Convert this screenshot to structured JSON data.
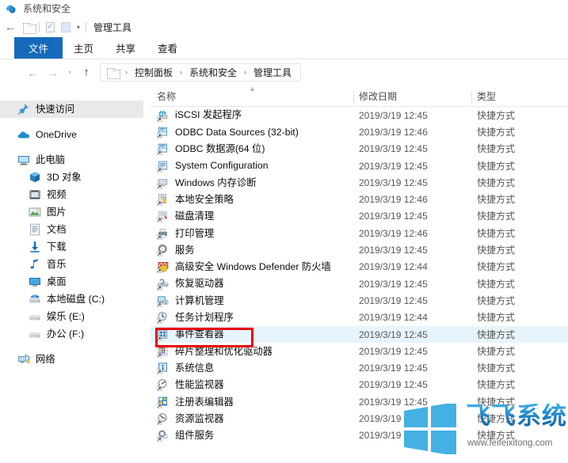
{
  "window": {
    "title": "系统和安全",
    "title_icon": "shield-security-icon"
  },
  "quick_access_toolbar": {
    "back_label": "←",
    "folder_icon": "folder-icon",
    "properties_icon": "properties-icon",
    "new_folder_icon": "new-folder-icon",
    "customize_caret": "▾",
    "window_title": "管理工具"
  },
  "ribbon": {
    "tabs": [
      {
        "label": "文件",
        "active": true
      },
      {
        "label": "主页",
        "active": false
      },
      {
        "label": "共享",
        "active": false
      },
      {
        "label": "查看",
        "active": false
      }
    ]
  },
  "address_bar": {
    "back_icon": "←",
    "forward_icon": "→",
    "recent_icon": "▾",
    "up_icon": "↑",
    "path_icon": "folder-icon",
    "separator": "›",
    "crumbs": [
      "控制面板",
      "系统和安全",
      "管理工具"
    ]
  },
  "sidebar": {
    "items": [
      {
        "label": "快速访问",
        "icon": "pin-icon",
        "indent": false,
        "selected": true
      },
      {
        "label": "OneDrive",
        "icon": "cloud-icon",
        "indent": false,
        "selected": false,
        "gap_before": true
      },
      {
        "label": "此电脑",
        "icon": "computer-icon",
        "indent": false,
        "selected": false,
        "gap_before": true
      },
      {
        "label": "3D 对象",
        "icon": "3d-objects-icon",
        "indent": true,
        "selected": false
      },
      {
        "label": "视频",
        "icon": "videos-icon",
        "indent": true,
        "selected": false
      },
      {
        "label": "图片",
        "icon": "pictures-icon",
        "indent": true,
        "selected": false
      },
      {
        "label": "文档",
        "icon": "documents-icon",
        "indent": true,
        "selected": false
      },
      {
        "label": "下载",
        "icon": "downloads-icon",
        "indent": true,
        "selected": false
      },
      {
        "label": "音乐",
        "icon": "music-icon",
        "indent": true,
        "selected": false
      },
      {
        "label": "桌面",
        "icon": "desktop-icon",
        "indent": true,
        "selected": false
      },
      {
        "label": "本地磁盘 (C:)",
        "icon": "system-drive-icon",
        "indent": true,
        "selected": false
      },
      {
        "label": "娱乐 (E:)",
        "icon": "drive-icon",
        "indent": true,
        "selected": false
      },
      {
        "label": "办公 (F:)",
        "icon": "drive-icon",
        "indent": true,
        "selected": false
      },
      {
        "label": "网络",
        "icon": "network-icon",
        "indent": false,
        "selected": false,
        "gap_before": true
      }
    ]
  },
  "file_list": {
    "columns": [
      {
        "label": "名称",
        "sorted": true,
        "sort_indicator": "▲"
      },
      {
        "label": "修改日期",
        "sorted": false
      },
      {
        "label": "类型",
        "sorted": false
      }
    ],
    "rows": [
      {
        "name": "iSCSI 发起程序",
        "date": "2019/3/19 12:45",
        "type": "快捷方式",
        "icon": "iscsi-icon",
        "hover": false
      },
      {
        "name": "ODBC Data Sources (32-bit)",
        "date": "2019/3/19 12:46",
        "type": "快捷方式",
        "icon": "odbc-icon",
        "hover": false
      },
      {
        "name": "ODBC 数据源(64 位)",
        "date": "2019/3/19 12:45",
        "type": "快捷方式",
        "icon": "odbc-icon",
        "hover": false
      },
      {
        "name": "System Configuration",
        "date": "2019/3/19 12:45",
        "type": "快捷方式",
        "icon": "msconfig-icon",
        "hover": false
      },
      {
        "name": "Windows 内存诊断",
        "date": "2019/3/19 12:45",
        "type": "快捷方式",
        "icon": "memory-diagnostic-icon",
        "hover": false
      },
      {
        "name": "本地安全策略",
        "date": "2019/3/19 12:46",
        "type": "快捷方式",
        "icon": "local-security-policy-icon",
        "hover": false
      },
      {
        "name": "磁盘清理",
        "date": "2019/3/19 12:45",
        "type": "快捷方式",
        "icon": "disk-cleanup-icon",
        "hover": false
      },
      {
        "name": "打印管理",
        "date": "2019/3/19 12:46",
        "type": "快捷方式",
        "icon": "print-management-icon",
        "hover": false
      },
      {
        "name": "服务",
        "date": "2019/3/19 12:45",
        "type": "快捷方式",
        "icon": "services-icon",
        "hover": false
      },
      {
        "name": "高级安全 Windows Defender 防火墙",
        "date": "2019/3/19 12:44",
        "type": "快捷方式",
        "icon": "firewall-icon",
        "hover": false
      },
      {
        "name": "恢复驱动器",
        "date": "2019/3/19 12:45",
        "type": "快捷方式",
        "icon": "recovery-drive-icon",
        "hover": false
      },
      {
        "name": "计算机管理",
        "date": "2019/3/19 12:45",
        "type": "快捷方式",
        "icon": "computer-management-icon",
        "hover": false
      },
      {
        "name": "任务计划程序",
        "date": "2019/3/19 12:44",
        "type": "快捷方式",
        "icon": "task-scheduler-icon",
        "hover": false
      },
      {
        "name": "事件查看器",
        "date": "2019/3/19 12:45",
        "type": "快捷方式",
        "icon": "event-viewer-icon",
        "hover": true
      },
      {
        "name": "碎片整理和优化驱动器",
        "date": "2019/3/19 12:45",
        "type": "快捷方式",
        "icon": "defrag-icon",
        "hover": false
      },
      {
        "name": "系统信息",
        "date": "2019/3/19 12:45",
        "type": "快捷方式",
        "icon": "system-info-icon",
        "hover": false
      },
      {
        "name": "性能监视器",
        "date": "2019/3/19 12:45",
        "type": "快捷方式",
        "icon": "performance-monitor-icon",
        "hover": false
      },
      {
        "name": "注册表编辑器",
        "date": "2019/3/19 12:45",
        "type": "快捷方式",
        "icon": "registry-editor-icon",
        "hover": false
      },
      {
        "name": "资源监视器",
        "date": "2019/3/19 12:45",
        "type": "快捷方式",
        "icon": "resource-monitor-icon",
        "hover": false
      },
      {
        "name": "组件服务",
        "date": "2019/3/19 12:45",
        "type": "快捷方式",
        "icon": "component-services-icon",
        "hover": false
      }
    ]
  },
  "annotation": {
    "target_row": "事件查看器",
    "color": "#e60000"
  },
  "watermark": {
    "brand": "飞飞系统",
    "url": "www.feifeixitong.com",
    "logo_icon": "windows-logo-icon",
    "color": "#1a7fc4"
  }
}
